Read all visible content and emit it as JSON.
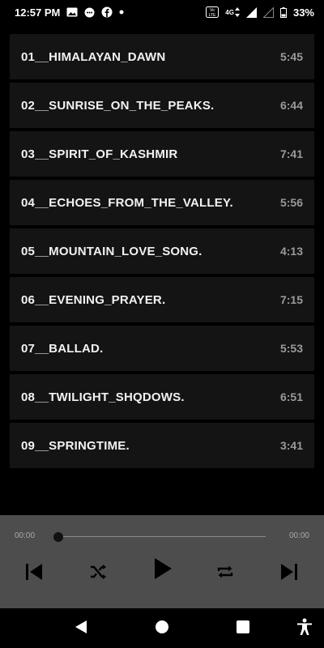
{
  "status_bar": {
    "time": "12:57 PM",
    "network_label": "4G",
    "battery_percent": "33%",
    "icons": [
      "image-icon",
      "message-icon",
      "facebook-icon",
      "dot-icon",
      "volte-icon",
      "data-arrows-icon",
      "signal-icon",
      "signal-empty-icon",
      "battery-icon"
    ]
  },
  "tracks": [
    {
      "title": "01__HIMALAYAN_DAWN",
      "duration": "5:45"
    },
    {
      "title": "02__SUNRISE_ON_THE_PEAKS.",
      "duration": "6:44"
    },
    {
      "title": "03__SPIRIT_OF_KASHMIR",
      "duration": "7:41"
    },
    {
      "title": "04__ECHOES_FROM_THE_VALLEY.",
      "duration": "5:56"
    },
    {
      "title": "05__MOUNTAIN_LOVE_SONG.",
      "duration": "4:13"
    },
    {
      "title": "06__EVENING_PRAYER.",
      "duration": "7:15"
    },
    {
      "title": "07__BALLAD.",
      "duration": "5:53"
    },
    {
      "title": "08__TWILIGHT_SHQDOWS.",
      "duration": "6:51"
    },
    {
      "title": "09__SPRINGTIME.",
      "duration": "3:41"
    }
  ],
  "player": {
    "elapsed": "00:00",
    "total": "00:00",
    "progress_fraction": 0,
    "controls": [
      "skip-previous-icon",
      "shuffle-icon",
      "play-icon",
      "repeat-icon",
      "skip-next-icon"
    ]
  },
  "nav_bar": {
    "icons": [
      "back-icon",
      "home-icon",
      "recents-icon",
      "accessibility-icon"
    ]
  }
}
